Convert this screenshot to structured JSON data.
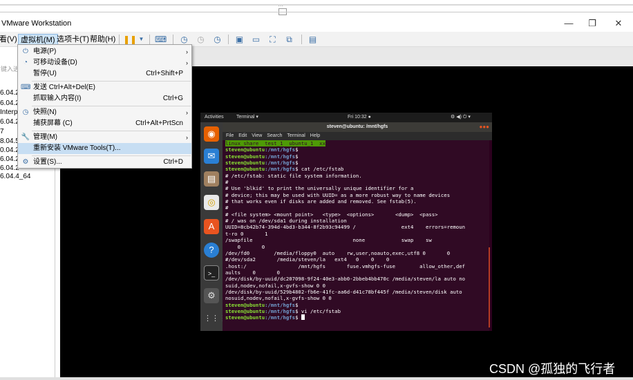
{
  "window": {
    "title": "VMware Workstation",
    "controls": [
      "—",
      "❐",
      "✕"
    ]
  },
  "menubar": {
    "items": [
      "看(V)",
      "虚拟机(M)",
      "选项卡(T)",
      "帮助(H)"
    ]
  },
  "left_panel": {
    "search_placeholder": "键入进行搜索",
    "items": [
      "6.04.2",
      "6.04.2",
      "Interp",
      "6.04.2",
      "7",
      "8.04.5",
      "0.04.2",
      "6.04.2",
      "6.04.2",
      "6.04.4_64"
    ]
  },
  "dropdown": {
    "items": [
      {
        "icon": "power-icon",
        "label": "电源(P)",
        "shortcut": "",
        "arrow": "›"
      },
      {
        "icon": "removable-device-icon",
        "label": "可移动设备(D)",
        "shortcut": "",
        "arrow": "›"
      },
      {
        "icon": "",
        "label": "暂停(U)",
        "shortcut": "Ctrl+Shift+P",
        "arrow": ""
      },
      {
        "icon": "keyboard-icon",
        "label": "发送 Ctrl+Alt+Del(E)",
        "shortcut": "",
        "arrow": ""
      },
      {
        "icon": "",
        "label": "抓取输入内容(I)",
        "shortcut": "Ctrl+G",
        "arrow": ""
      },
      {
        "icon": "snapshot-icon",
        "label": "快照(N)",
        "shortcut": "",
        "arrow": "›"
      },
      {
        "icon": "",
        "label": "捕获屏幕 (C)",
        "shortcut": "Ctrl+Alt+PrtScn",
        "arrow": ""
      },
      {
        "icon": "wrench-icon",
        "label": "管理(M)",
        "shortcut": "",
        "arrow": "›"
      },
      {
        "icon": "",
        "label": "重新安装 VMware Tools(T)...",
        "shortcut": "",
        "arrow": ""
      },
      {
        "icon": "settings-icon",
        "label": "设置(S)...",
        "shortcut": "Ctrl+D",
        "arrow": ""
      }
    ]
  },
  "guest": {
    "activities": "Activities",
    "app": "Terminal ▾",
    "clock": "Fri 10:32 ●",
    "tray": "⚙ ◀) ⏻ ▾",
    "term_title": "steven@ubuntu: /mnt/hgfs",
    "term_menu": [
      "File",
      "Edit",
      "View",
      "Search",
      "Terminal",
      "Help"
    ],
    "prompt_user": "steven@ubuntu",
    "prompt_path": ":/mnt/hgfs",
    "first_line": "linux_share  test_1  ubuntu_1  xx",
    "lines": [
      {
        "type": "prompt",
        "cmd": ""
      },
      {
        "type": "prompt",
        "cmd": ""
      },
      {
        "type": "prompt",
        "cmd": ""
      },
      {
        "type": "prompt",
        "cmd": " cat /etc/fstab"
      },
      {
        "type": "out",
        "text": "# /etc/fstab: static file system information."
      },
      {
        "type": "out",
        "text": "#"
      },
      {
        "type": "out",
        "text": "# Use 'blkid' to print the universally unique identifier for a"
      },
      {
        "type": "out",
        "text": "# device; this may be used with UUID= as a more robust way to name devices"
      },
      {
        "type": "out",
        "text": "# that works even if disks are added and removed. See fstab(5)."
      },
      {
        "type": "out",
        "text": "#"
      },
      {
        "type": "out",
        "text": "# <file system> <mount point>   <type>  <options>       <dump>  <pass>"
      },
      {
        "type": "out",
        "text": "# / was on /dev/sda1 during installation"
      },
      {
        "type": "out",
        "text": "UUID=8cb42b74-394d-4bd3-b344-8f2b93c94499 /               ext4    errors=remoun"
      },
      {
        "type": "out",
        "text": "t-ro 0       1"
      },
      {
        "type": "out",
        "text": "/swapfile                                 none            swap    sw"
      },
      {
        "type": "out",
        "text": "    0       0"
      },
      {
        "type": "out",
        "text": "/dev/fd0        /media/floppy0  auto    rw,user,noauto,exec,utf8 0       0"
      },
      {
        "type": "out",
        "text": "#/dev/sda2       /media/steven/la   ext4   0    0    0"
      },
      {
        "type": "out",
        "text": ".host:/                 /mnt/hgfs       fuse.vmhgfs-fuse        allow_other,def"
      },
      {
        "type": "out",
        "text": "aults    0       0"
      },
      {
        "type": "out",
        "text": "/dev/disk/by-uuid/dc207098-9f24-40e3-abb0-2bbeb4bb470c /media/steven/la auto no"
      },
      {
        "type": "out",
        "text": "suid,nodev,nofail,x-gvfs-show 0 0"
      },
      {
        "type": "out",
        "text": "/dev/disk/by-uuid/529b4802-fb6e-41fc-aa6d-d41c78bf445f /media/steven/disk auto"
      },
      {
        "type": "out",
        "text": "nosuid,nodev,nofail,x-gvfs-show 0 0"
      },
      {
        "type": "prompt",
        "cmd": ""
      },
      {
        "type": "prompt",
        "cmd": " vi /etc/fstab"
      },
      {
        "type": "prompt",
        "cmd": " ",
        "cursor": true
      }
    ]
  },
  "watermark": "CSDN @孤独的飞行者"
}
